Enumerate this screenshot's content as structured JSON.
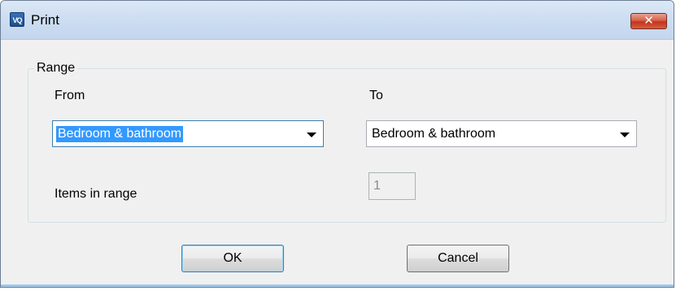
{
  "window": {
    "title": "Print",
    "app_icon_text": "VQ",
    "close_glyph": "✕"
  },
  "range": {
    "legend": "Range",
    "from_label": "From",
    "to_label": "To",
    "from_value": "Bedroom & bathroom",
    "to_value": "Bedroom & bathroom",
    "items_label": "Items in range",
    "items_value": "1"
  },
  "buttons": {
    "ok": "OK",
    "cancel": "Cancel"
  }
}
